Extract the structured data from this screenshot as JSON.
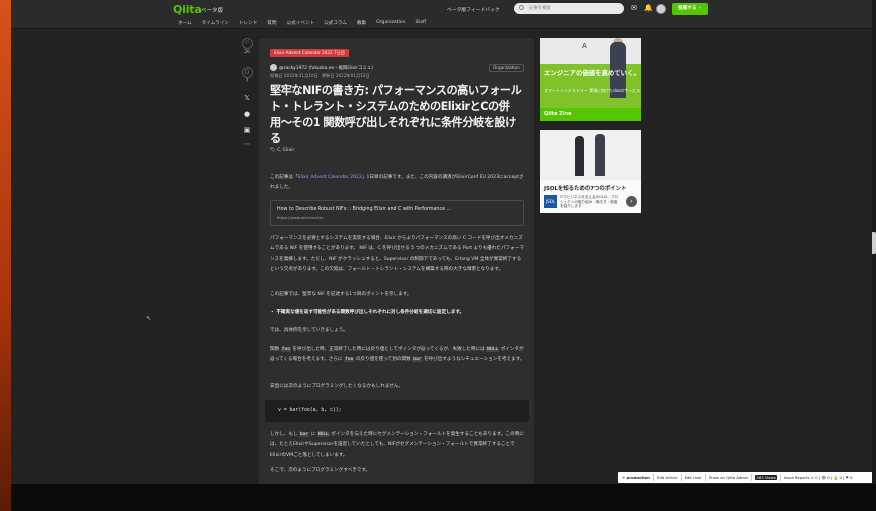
{
  "header": {
    "logo": "Qiita",
    "logo_sub": "ベータ版",
    "nav": [
      "ホーム",
      "タイムライン",
      "トレンド",
      "質問",
      "公式イベント",
      "公式コラム",
      "募集",
      "Organization",
      "Staff"
    ],
    "feedback": "ベータ版フィードバック",
    "search_placeholder": "記事を検索",
    "post_button": "投稿する ✓"
  },
  "actions": {
    "like_count": "20",
    "stock_count": "7"
  },
  "article": {
    "calendar_tag": "Elixir Advent Calendar 2022 7日目",
    "author": "@zacky1972 (fukuoka.ex・福岡Elixirコミュ)",
    "org_badge": "Organization",
    "dates": "投稿日 2022年11月10日　更新日 2022年01月12日",
    "title": "堅牢なNIFの書き方: パフォーマンスの高いフォールト・トレラント・システムのためのElixirとCの併用〜その1 関数呼び出しそれぞれに条件分岐を設ける",
    "tags": "C, Elixir",
    "intro_prefix": "この記事は「",
    "intro_link": "Elixir Advent Calendar 2022",
    "intro_suffix": "」1日目の記事です。また、この内容の講演がElixirConf EU 2023にacceptされました。",
    "link_card_title": "How to Describe Robust NIFs: : Bridging Elixir and C with Performance ...",
    "link_card_url": "https://www.elixirconf.eu",
    "para1": "パフォーマンスを必要とするシステムを実装する場合、Elixir からよりパフォーマンスの高い C コードを呼び出すメカニズムである NIF を使用することがあります。 NIF は、C を呼び出せる 5 つのメカニズムである Port よりも優れたパフォーマンスを発揮します。ただし、NIF がクラッシュすると、Supervisor の制御下であっても、Erlang VM 全体が異常終了するという欠点があります。この欠陥は、フォールト・トレラント・システムを構築する際の大きな障害となります。",
    "para2": "この記事では、堅牢な NIF を記述する1つ目のポイントを示します。",
    "bullet": "・ 不確実な値を返す可能性がある関数呼び出しそれぞれに対し条件分岐を適切に設定します。",
    "para3": "では、具体例を示していきましょう。",
    "para4_a": "関数 ",
    "code_foo": "foo",
    "para4_b": " を呼び出した時、正常終了した時には戻り値としてポインタが返ってくるが、失敗した時には ",
    "code_null": "NULL",
    "para4_c": " ポインタが返ってくる場合を考えます。さらに ",
    "code_foo2": "foo",
    "para4_d": " の戻り値を使って別の関数 ",
    "code_bar": "bar",
    "para4_e": " を呼び出すようなシチュエーションを考えます。",
    "para5": "安直には次のようにプログラミングしたくなるかもしれません。",
    "code_line": "v = bar(foo(a, b, c));",
    "para6_a": "しかし、もし ",
    "code_bar2": "bar",
    "para6_b": " に ",
    "code_null2": "NULL",
    "para6_c": " ポインタを与えた時にセグメンテーション・フォールトを発生することもあります。この時には、たとえElixirやSupervisorを設定していたとしても、NIFがセグメンテーション・フォールトで異常終了することでElixirのVMごと落としてしまいます。",
    "para7": "そこで、次のようにプログラミングすべきです。"
  },
  "ads": {
    "ad1_logo": "A",
    "ad1_headline": "エンジニアの価値を高めていく。",
    "ad1_sub": "スマートインテストリー 実現に向けたdxsのサービス",
    "ad1_footer": "Qiita Zine",
    "ad2_headline": "JSOLを知るための7つのポイント",
    "ad2_logo": "JSOL",
    "ad2_sub": "ITでビジネスを支えるJSOLの、プロジェクトの取り組み・働き方・制度を紹介します"
  },
  "prod_bar": {
    "env": "✕ production",
    "items": [
      "Edit Article",
      "Edit User",
      "Show on Qiita Admin"
    ],
    "views": "563 Views",
    "reports": "Issue Reports ⚠ 0 | 👁 0 | 🔒 0 | ⚑ 0"
  }
}
